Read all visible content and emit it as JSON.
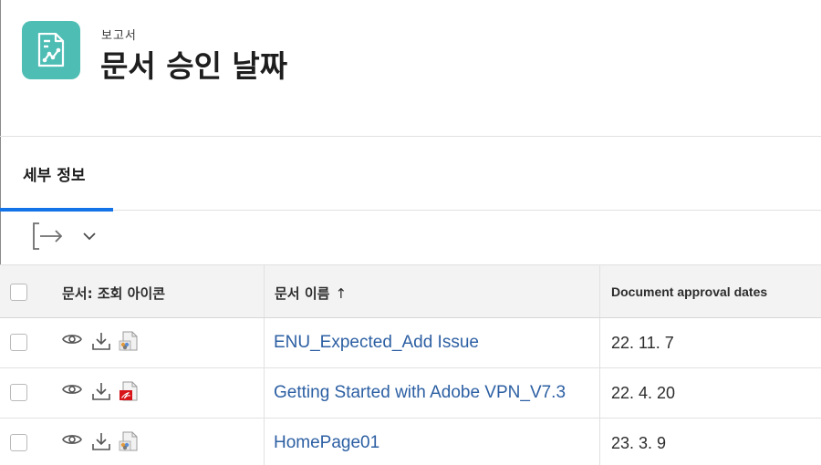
{
  "header": {
    "subtitle": "보고서",
    "title": "문서 승인 날짜",
    "icon": "report-chart-icon",
    "icon_color": "#4ebdb4"
  },
  "tabs": [
    {
      "label": "세부 정보",
      "active": true
    }
  ],
  "toolbar": {
    "export_icon": "export-icon",
    "menu_icon": "chevron-down-icon"
  },
  "table": {
    "columns": {
      "icons": "문서: 조회 아이콘",
      "name": "문서 이름",
      "name_sort": "↑",
      "date": "Document approval dates"
    },
    "rows": [
      {
        "file_type": "generic",
        "name": "ENU_Expected_Add Issue",
        "date": "22. 11. 7"
      },
      {
        "file_type": "pdf",
        "name": "Getting Started with Adobe VPN_V7.3",
        "date": "22. 4. 20"
      },
      {
        "file_type": "generic",
        "name": "HomePage01",
        "date": "23. 3. 9"
      }
    ]
  },
  "colors": {
    "accent": "#1473e6",
    "link": "#2c5fa3",
    "pdf_red": "#d7141a"
  }
}
